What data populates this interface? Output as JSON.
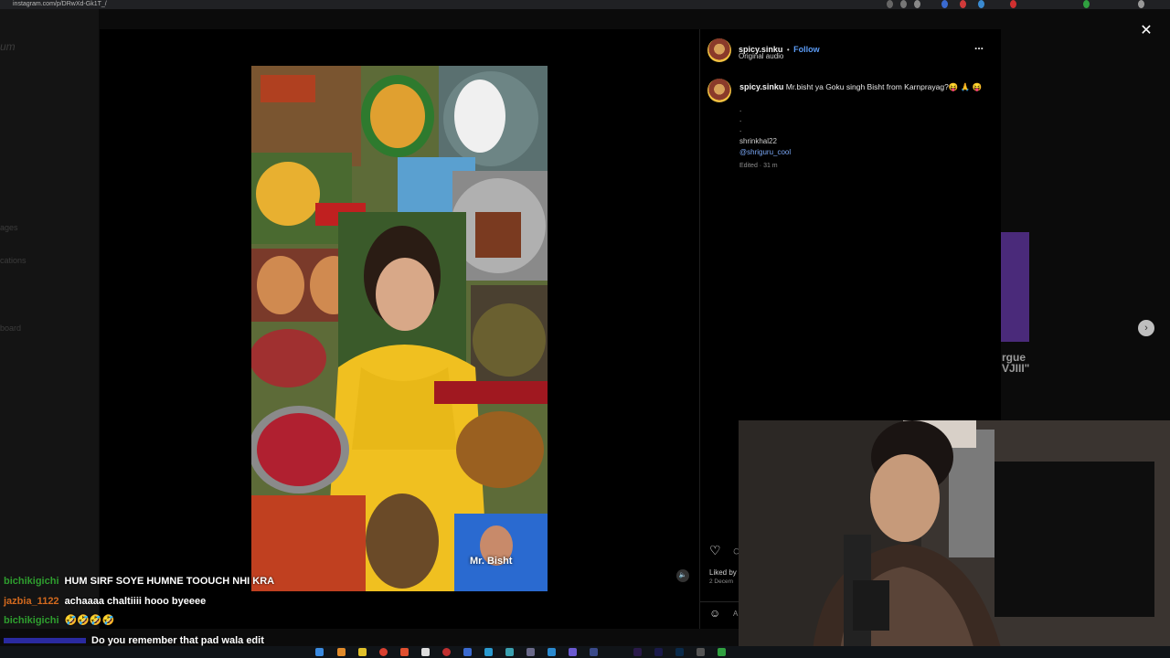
{
  "browser": {
    "url": "instagram.com/p/DRwXd-Gk1T_/"
  },
  "background_sidebar": {
    "items": [
      "um",
      "ages",
      "cations",
      "board"
    ]
  },
  "post": {
    "author": "spicy.sinku",
    "separator": "•",
    "follow_label": "Follow",
    "audio": "Original audio",
    "more_label": "...",
    "caption_author": "spicy.sinku",
    "caption_text": "Mr.bisht ya Goku singh Bisht from Karnprayag?😝 🙏 😝",
    "dots": [
      ".",
      ".",
      "."
    ],
    "tag_plain": "shrinkhal22",
    "tag_link": "@shriguru_cool",
    "edited": "Edited · 31 m",
    "liked_by": "Liked by",
    "date": "2 Decem",
    "comment_placeholder": "A",
    "reel_overlay_text": "Mr. Bisht"
  },
  "modal": {
    "close_label": "✕",
    "next_label": "›"
  },
  "background_ghost_text": {
    "line1": "rgue",
    "line2": "VJIII\""
  },
  "chat": {
    "messages": [
      {
        "user": "bichikigichi",
        "text": "HUM SIRF SOYE HUMNE TOOUCH NHI KRA",
        "color": "#2e9e2e"
      },
      {
        "user": "jazbia_1122",
        "text": "achaaaa chaltiiii hooo byeeee",
        "color": "#d2691e"
      },
      {
        "user": "bichikigichi",
        "text": "🤣🤣🤣🤣",
        "color": "#2e9e2e"
      },
      {
        "user": "",
        "text": "Do you remember that pad wala edit",
        "color": "#3a3aff"
      }
    ]
  },
  "colors": {
    "accent_link": "#5b9bf5",
    "panel_bg": "#000000"
  }
}
